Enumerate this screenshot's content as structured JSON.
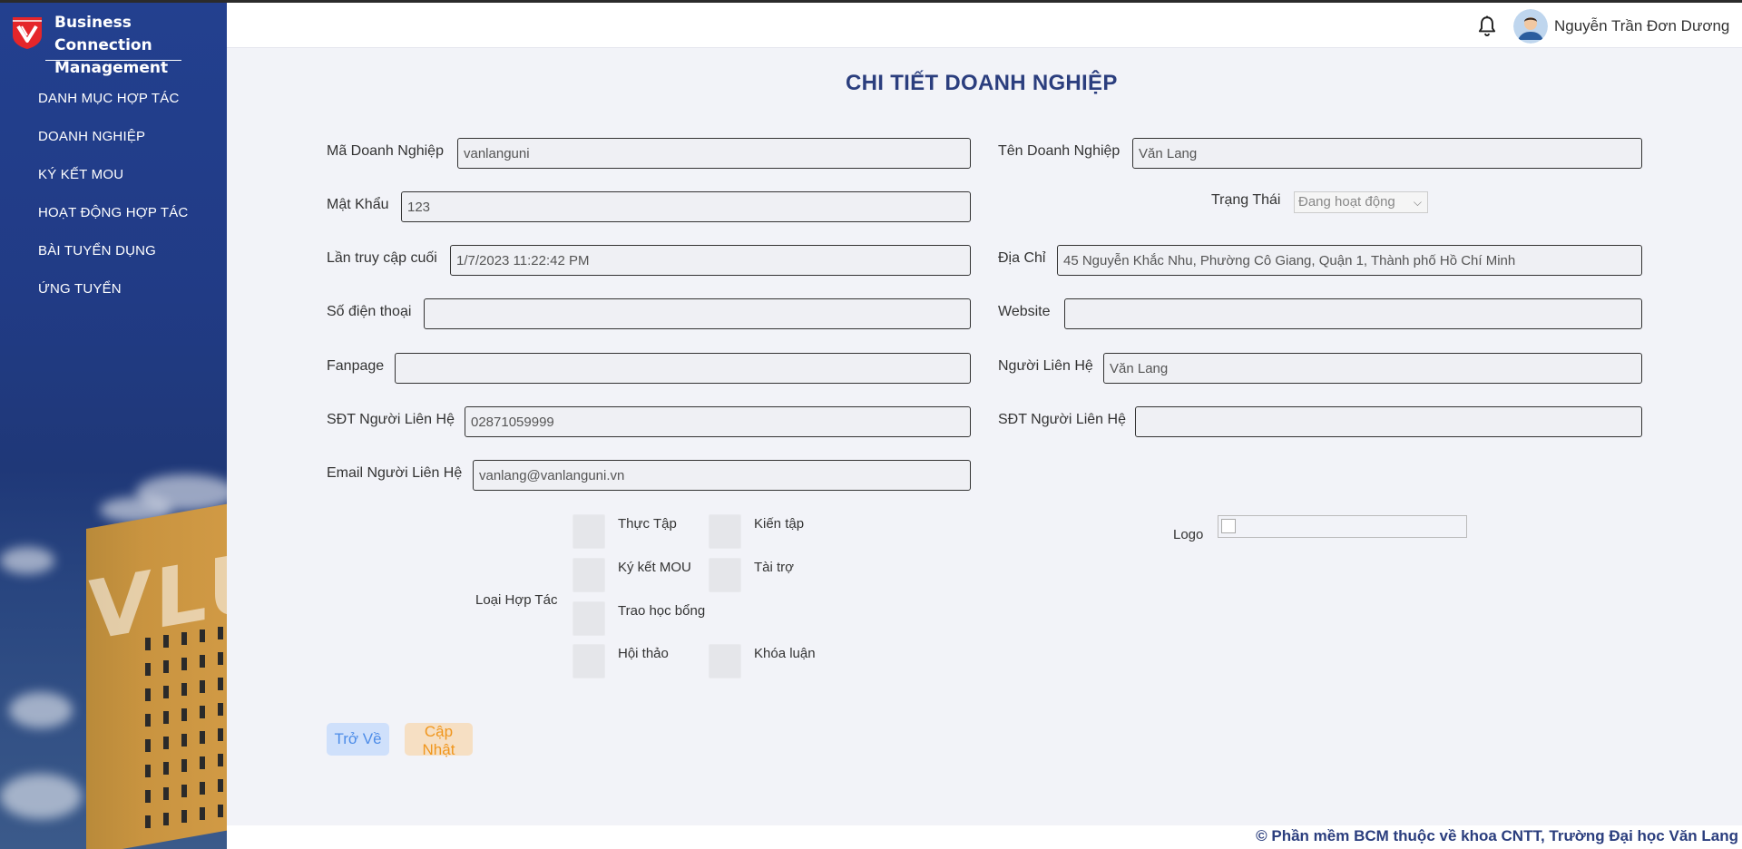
{
  "brand": {
    "title": "Business Connection Management",
    "accent": "#e5262a"
  },
  "sidebar": {
    "items": [
      {
        "label": "DANH MỤC HỢP TÁC"
      },
      {
        "label": "DOANH NGHIỆP"
      },
      {
        "label": "KÝ KẾT MOU"
      },
      {
        "label": "HOẠT ĐỘNG HỢP TÁC"
      },
      {
        "label": "BÀI TUYỂN DỤNG"
      },
      {
        "label": "ỨNG TUYỂN"
      }
    ],
    "background_text": "VLU"
  },
  "header": {
    "user_name": "Nguyễn Trần Đơn Dương",
    "bell_icon": "bell-icon"
  },
  "page": {
    "title": "CHI TIẾT DOANH NGHIỆP",
    "fields": {
      "ma_dn": {
        "label": "Mã Doanh Nghiệp",
        "value": "vanlanguni"
      },
      "ten_dn": {
        "label": "Tên Doanh Nghiệp",
        "value": "Văn Lang"
      },
      "mat_khau": {
        "label": "Mật Khẩu",
        "value": "123"
      },
      "trang_thai": {
        "label": "Trạng Thái",
        "value": "Đang hoạt động"
      },
      "lan_truy_cap": {
        "label": "Lần truy cập cuối",
        "value": "1/7/2023 11:22:42 PM"
      },
      "dia_chi": {
        "label": "Địa Chỉ",
        "value": "45 Nguyễn Khắc Nhu, Phường Cô Giang, Quận 1, Thành phố Hồ Chí Minh"
      },
      "so_dien_thoai": {
        "label": "Số điện thoại",
        "value": ""
      },
      "website": {
        "label": "Website",
        "value": ""
      },
      "fanpage": {
        "label": "Fanpage",
        "value": ""
      },
      "nguoi_lien_he": {
        "label": "Người Liên Hệ",
        "value": "Văn Lang"
      },
      "sdt_nguoi_lien_he": {
        "label": "SĐT Người Liên Hệ",
        "value": "02871059999"
      },
      "sdt_nguoi_lien_he_2": {
        "label": "SĐT Người Liên Hệ",
        "value": ""
      },
      "email_nguoi_lien_he": {
        "label": "Email Người Liên Hệ",
        "value": "vanlang@vanlanguni.vn"
      }
    },
    "loai_hop_tac": {
      "label": "Loại Hợp Tác",
      "options": [
        {
          "label": "Thực Tập"
        },
        {
          "label": "Kiến tập"
        },
        {
          "label": "Ký kết MOU"
        },
        {
          "label": "Tài trợ"
        },
        {
          "label": "Trao học bổng"
        },
        {
          "label": "Hội thảo"
        },
        {
          "label": "Khóa luận"
        }
      ]
    },
    "logo_label": "Logo",
    "buttons": {
      "back": "Trở Về",
      "update": "Cập Nhật"
    }
  },
  "footer": {
    "text": "© Phần mềm BCM thuộc về khoa CNTT, Trường Đại học Văn Lang"
  }
}
